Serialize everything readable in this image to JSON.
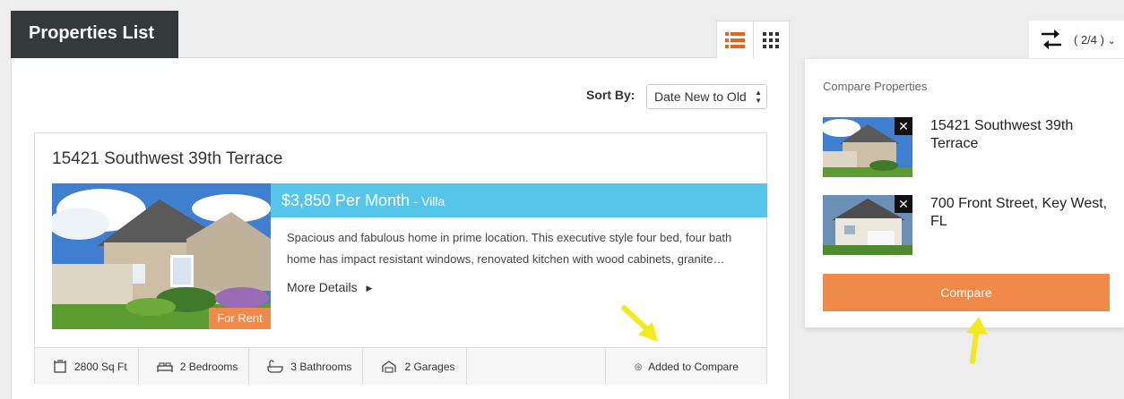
{
  "header": {
    "title": "Properties List"
  },
  "view_toggle": {
    "list_icon": "list-view-icon",
    "grid_icon": "grid-view-icon",
    "active": "list",
    "accent": "#e8641e"
  },
  "sort": {
    "label": "Sort By:",
    "value": "Date New to Old"
  },
  "listing": {
    "title": "15421 Southwest 39th Terrace",
    "badge": "For Rent",
    "price": "$3,850 Per Month",
    "type": "- Villa",
    "description": "Spacious and fabulous home in prime location. This executive style four bed, four bath home has impact resistant windows, renovated kitchen with wood cabinets, granite…",
    "more_details": "More Details",
    "features": [
      {
        "icon": "area-icon",
        "label": "2800 Sq Ft"
      },
      {
        "icon": "bed-icon",
        "label": "2 Bedrooms"
      },
      {
        "icon": "bathtub-icon",
        "label": "3 Bathrooms"
      },
      {
        "icon": "garage-icon",
        "label": "2 Garages"
      }
    ],
    "compare_status": "Added to Compare"
  },
  "compare": {
    "count": "( 2/4 )",
    "heading": "Compare Properties",
    "items": [
      {
        "name": "15421 Southwest 39th Terrace"
      },
      {
        "name": "700 Front Street, Key West, FL"
      }
    ],
    "button": "Compare"
  },
  "colors": {
    "orange": "#ef8a4b",
    "price_bar": "#55c6ea",
    "title_bg": "#333a3a",
    "annotation_arrow": "#f2ea1c"
  }
}
